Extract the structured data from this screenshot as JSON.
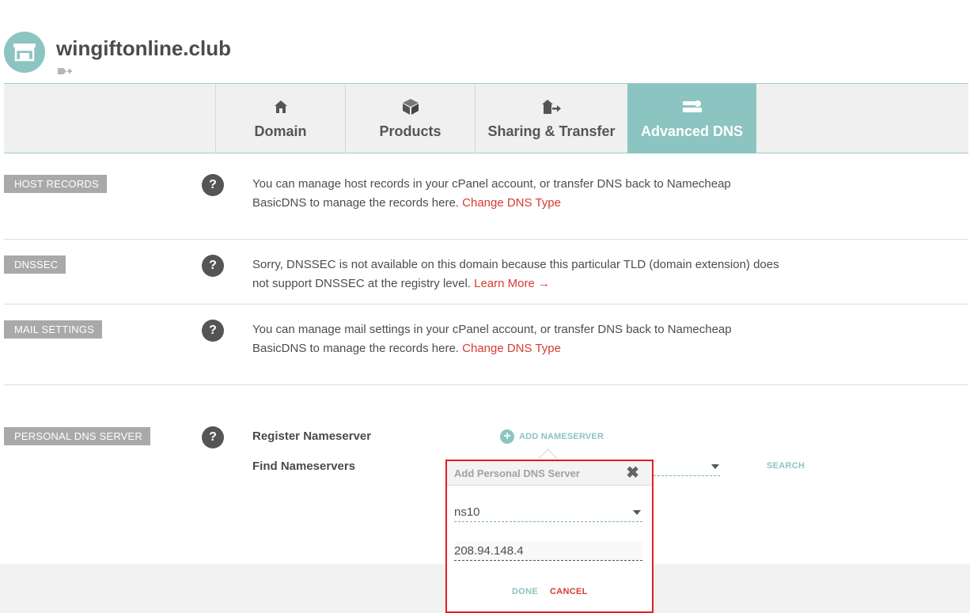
{
  "header": {
    "domain": "wingiftonline.club",
    "logo_icon": "store-icon",
    "tag_icon": "add-tag-icon"
  },
  "tabs": [
    {
      "label": "Domain",
      "icon": "home-icon",
      "active": false
    },
    {
      "label": "Products",
      "icon": "box-icon",
      "active": false
    },
    {
      "label": "Sharing & Transfer",
      "icon": "transfer-icon",
      "active": false
    },
    {
      "label": "Advanced DNS",
      "icon": "server-icon",
      "active": true
    }
  ],
  "sections": {
    "host_records": {
      "label": "HOST RECORDS",
      "line1": "You can manage host records in your cPanel account, or transfer DNS back to Namecheap",
      "line2": "BasicDNS to manage the records here. ",
      "link": "Change DNS Type"
    },
    "dnssec": {
      "label": "DNSSEC",
      "line1": "Sorry, DNSSEC is not available on this domain because this particular TLD (domain extension) does",
      "line2": "not support DNSSEC at the registry level. ",
      "link": "Learn More →"
    },
    "mail_settings": {
      "label": "MAIL SETTINGS",
      "line1": "You can manage mail settings in your cPanel account, or transfer DNS back to Namecheap",
      "line2": "BasicDNS to manage the records here. ",
      "link": "Change DNS Type"
    },
    "personal_dns": {
      "label": "PERSONAL DNS SERVER",
      "register_label": "Register Nameserver",
      "add_button": "ADD NAMESERVER",
      "find_label": "Find Nameservers",
      "search_button": "SEARCH"
    }
  },
  "help_glyph": "?",
  "popup": {
    "title": "Add Personal DNS Server",
    "close_glyph": "✖",
    "nameserver_value": "ns10",
    "ip_value": "208.94.148.4",
    "done": "DONE",
    "cancel": "CANCEL"
  },
  "colors": {
    "accent": "#8cc4c1",
    "link_red": "#d73b2f",
    "highlight_border": "#e01e26"
  }
}
